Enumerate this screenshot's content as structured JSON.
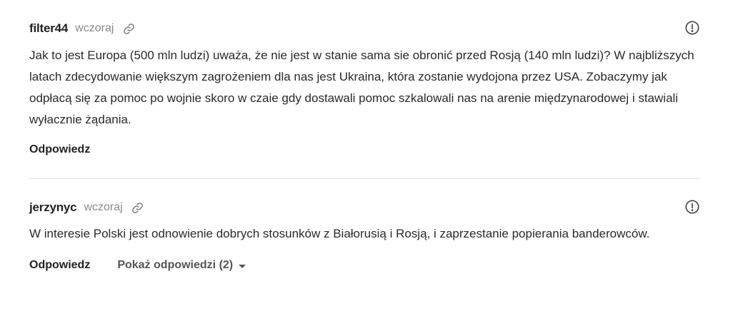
{
  "comments": [
    {
      "author": "filter44",
      "time": "wczoraj",
      "text": "Jak to jest Europa (500 mln ludzi) uważa, że nie jest w stanie sama sie obronić przed Rosją (140 mln ludzi)? W najbliższych latach zdecydowanie większym zagrożeniem dla nas jest Ukraina, która zostanie wydojona przez USA. Zobaczymy jak odpłacą się za pomoc po wojnie skoro w czaie gdy dostawali pomoc szkalowali nas na arenie międzynarodowej i stawiali wyłacznie żądania.",
      "reply_label": "Odpowiedz"
    },
    {
      "author": "jerzynyc",
      "time": "wczoraj",
      "text": "W interesie Polski jest odnowienie dobrych stosunków z Białorusią i Rosją, i zaprzestanie popierania banderowców.",
      "reply_label": "Odpowiedz",
      "show_replies_label": "Pokaż odpowiedzi (2)"
    }
  ],
  "icons": {
    "permalink": "link-icon",
    "report": "report-icon",
    "expand": "chevron-down-icon"
  },
  "colors": {
    "text": "#222222",
    "muted": "#8a8a8a",
    "divider": "#e4e4e4"
  }
}
